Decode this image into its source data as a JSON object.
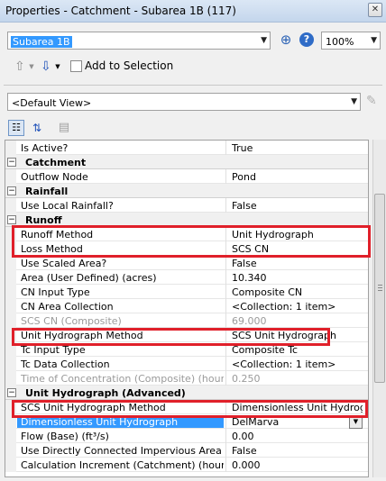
{
  "window": {
    "title": "Properties - Catchment - Subarea 1B (117)",
    "close_glyph": "✕"
  },
  "element_combo": {
    "value": "Subarea 1B"
  },
  "zoom_combo": {
    "value": "100%"
  },
  "toolbar": {
    "add_to_selection_label": "Add to Selection",
    "back_glyph": "⇧",
    "nav_glyph": "⇩",
    "zoom_glyph": "⊕",
    "help_glyph": "?",
    "categorized_glyph": "☷",
    "sort_glyph": "⇅",
    "pages_glyph": "▤"
  },
  "view_combo": {
    "value": "<Default View>"
  },
  "grid_rows": [
    {
      "type": "property",
      "name": "Is Active?",
      "value": "True"
    },
    {
      "type": "category",
      "name": "Catchment",
      "toggle": "−"
    },
    {
      "type": "property",
      "name": "Outflow Node",
      "value": "Pond"
    },
    {
      "type": "category",
      "name": "Rainfall",
      "toggle": "−"
    },
    {
      "type": "property",
      "name": "Use Local Rainfall?",
      "value": "False"
    },
    {
      "type": "category",
      "name": "Runoff",
      "toggle": "−"
    },
    {
      "type": "property",
      "name": "Runoff Method",
      "value": "Unit Hydrograph"
    },
    {
      "type": "property",
      "name": "Loss Method",
      "value": "SCS CN"
    },
    {
      "type": "property",
      "name": "Use Scaled Area?",
      "value": "False"
    },
    {
      "type": "property",
      "name": "Area (User Defined) (acres)",
      "value": "10.340"
    },
    {
      "type": "property",
      "name": "CN Input Type",
      "value": "Composite CN"
    },
    {
      "type": "property",
      "name": "CN Area Collection",
      "value": "<Collection: 1 item>"
    },
    {
      "type": "disabled",
      "name": "SCS CN (Composite)",
      "value": "69.000"
    },
    {
      "type": "property",
      "name": "Unit Hydrograph Method",
      "value": "SCS Unit Hydrograph"
    },
    {
      "type": "property",
      "name": "Tc Input Type",
      "value": "Composite Tc"
    },
    {
      "type": "property",
      "name": "Tc Data Collection",
      "value": "<Collection: 1 item>"
    },
    {
      "type": "disabled",
      "name": "Time of Concentration (Composite) (hours)",
      "value": "0.250"
    },
    {
      "type": "category",
      "name": "Unit Hydrograph (Advanced)",
      "toggle": "−"
    },
    {
      "type": "property",
      "name": "SCS Unit Hydrograph Method",
      "value": "Dimensionless Unit Hydrograph"
    },
    {
      "type": "selected",
      "name": "Dimensionless Unit Hydrograph",
      "value": "DelMarva"
    },
    {
      "type": "property",
      "name": "Flow (Base) (ft³/s)",
      "value": "0.00"
    },
    {
      "type": "property",
      "name": "Use Directly Connected Impervious Area",
      "value": "False"
    },
    {
      "type": "property",
      "name": "Calculation Increment (Catchment) (hours)",
      "value": "0.000"
    }
  ],
  "highlight_color": "#e0202a"
}
